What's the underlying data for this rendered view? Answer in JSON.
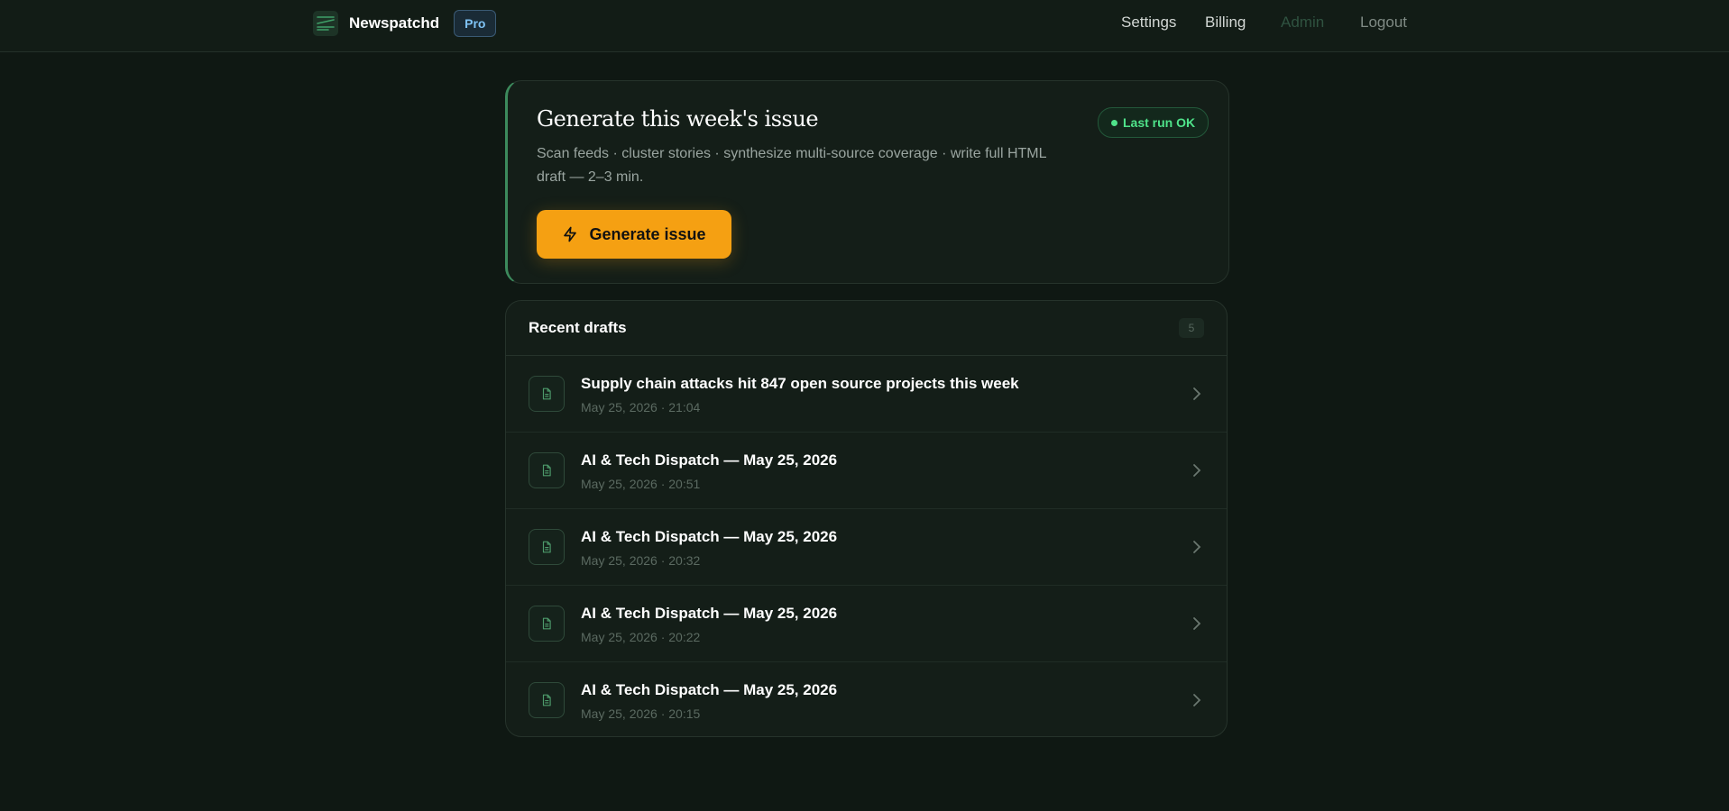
{
  "header": {
    "brand": "Newspatchd",
    "plan_badge": "Pro",
    "nav": {
      "settings": "Settings",
      "billing": "Billing",
      "admin": "Admin",
      "logout": "Logout"
    }
  },
  "generate": {
    "title": "Generate this week's issue",
    "description": "Scan feeds · cluster stories · synthesize multi-source coverage · write full HTML draft — 2–3 min.",
    "status": "Last run OK",
    "button_label": "Generate issue"
  },
  "drafts": {
    "title": "Recent drafts",
    "count": "5",
    "items": [
      {
        "title": "Supply chain attacks hit 847 open source projects this week",
        "date": "May 25, 2026 · 21:04"
      },
      {
        "title": "AI & Tech Dispatch — May 25, 2026",
        "date": "May 25, 2026 · 20:51"
      },
      {
        "title": "AI & Tech Dispatch — May 25, 2026",
        "date": "May 25, 2026 · 20:32"
      },
      {
        "title": "AI & Tech Dispatch — May 25, 2026",
        "date": "May 25, 2026 · 20:22"
      },
      {
        "title": "AI & Tech Dispatch — May 25, 2026",
        "date": "May 25, 2026 · 20:15"
      }
    ]
  },
  "colors": {
    "background": "#0f1813",
    "accent": "#f5a012",
    "success": "#4fe38a",
    "pro_badge": "#7fc3f5"
  },
  "icons": {
    "logo": "newspaper-logo-icon",
    "status": "status-dot-icon",
    "button": "lightning-bolt-icon",
    "draft": "document-icon",
    "row_arrow": "chevron-right-icon"
  }
}
